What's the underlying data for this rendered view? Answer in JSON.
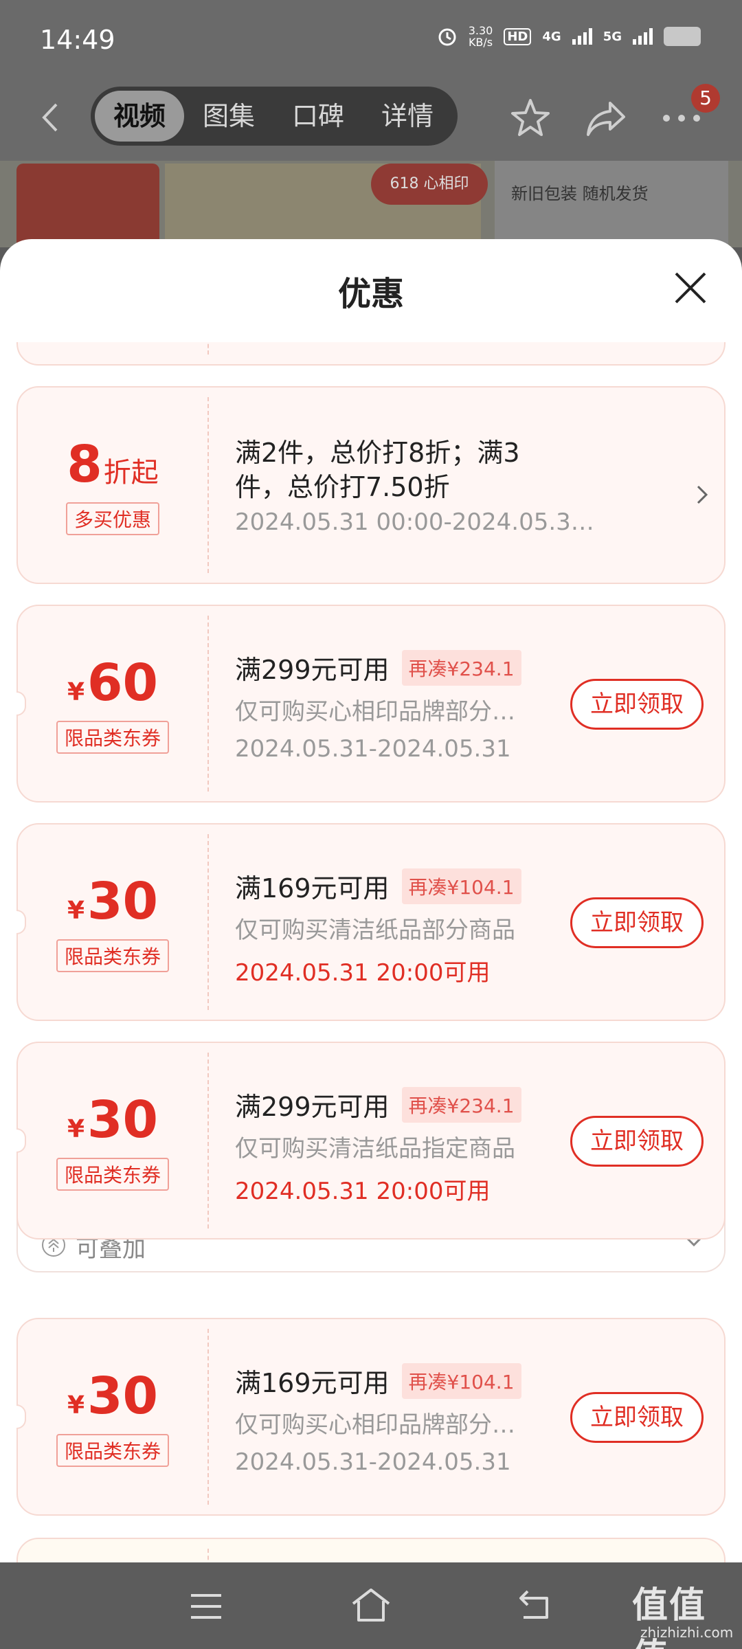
{
  "status": {
    "time": "14:49",
    "speed_top": "3.30",
    "speed_unit": "KB/s",
    "hd": "HD",
    "network_4g": "4G",
    "network_5g": "5G"
  },
  "nav": {
    "tabs": [
      "视频",
      "图集",
      "口碑",
      "详情"
    ],
    "active_tab": "视频",
    "badge": "5"
  },
  "background": {
    "logo_text": "心相印",
    "event_text": "618",
    "caption": "新旧包装 随机发货"
  },
  "sheet": {
    "title": "优惠",
    "cards": [
      {
        "amount_num": "8",
        "amount_suffix": "折起",
        "tag": "多买优惠",
        "line1": "满2件，总价打8折；满3",
        "line1b": "件，总价打7.50折",
        "line3": "2024.05.31 00:00-2024.05.3…",
        "type": "discount"
      },
      {
        "currency": "¥",
        "amount_num": "60",
        "tag": "限品类东券",
        "line1": "满299元可用",
        "extra": "再凑¥234.1",
        "line2": "仅可购买心相印品牌部分…",
        "line3": "2024.05.31-2024.05.31",
        "button": "立即领取"
      },
      {
        "currency": "¥",
        "amount_num": "30",
        "tag": "限品类东券",
        "line1": "满169元可用",
        "extra": "再凑¥104.1",
        "line2": "仅可购买清洁纸品部分商品",
        "line3": "2024.05.31 20:00可用",
        "button": "立即领取"
      },
      {
        "currency": "¥",
        "amount_num": "30",
        "tag": "限品类东券",
        "line1": "满299元可用",
        "extra": "再凑¥234.1",
        "line2": "仅可购买清洁纸品指定商品",
        "line3": "2024.05.31 20:00可用",
        "button": "立即领取"
      },
      {
        "currency": "¥",
        "amount_num": "30",
        "tag": "限品类东券",
        "line1": "满169元可用",
        "extra": "再凑¥104.1",
        "line2": "仅可购买心相印品牌部分…",
        "line3": "2024.05.31-2024.05.31",
        "button": "立即领取"
      }
    ],
    "stackable_label": "可叠加"
  },
  "watermark": {
    "main": "值值值",
    "sub": "zhizhizhi.com"
  },
  "colors": {
    "accent": "#e02e24",
    "card_bg": "#fff6f4",
    "extra_bg": "#fde0dc"
  }
}
